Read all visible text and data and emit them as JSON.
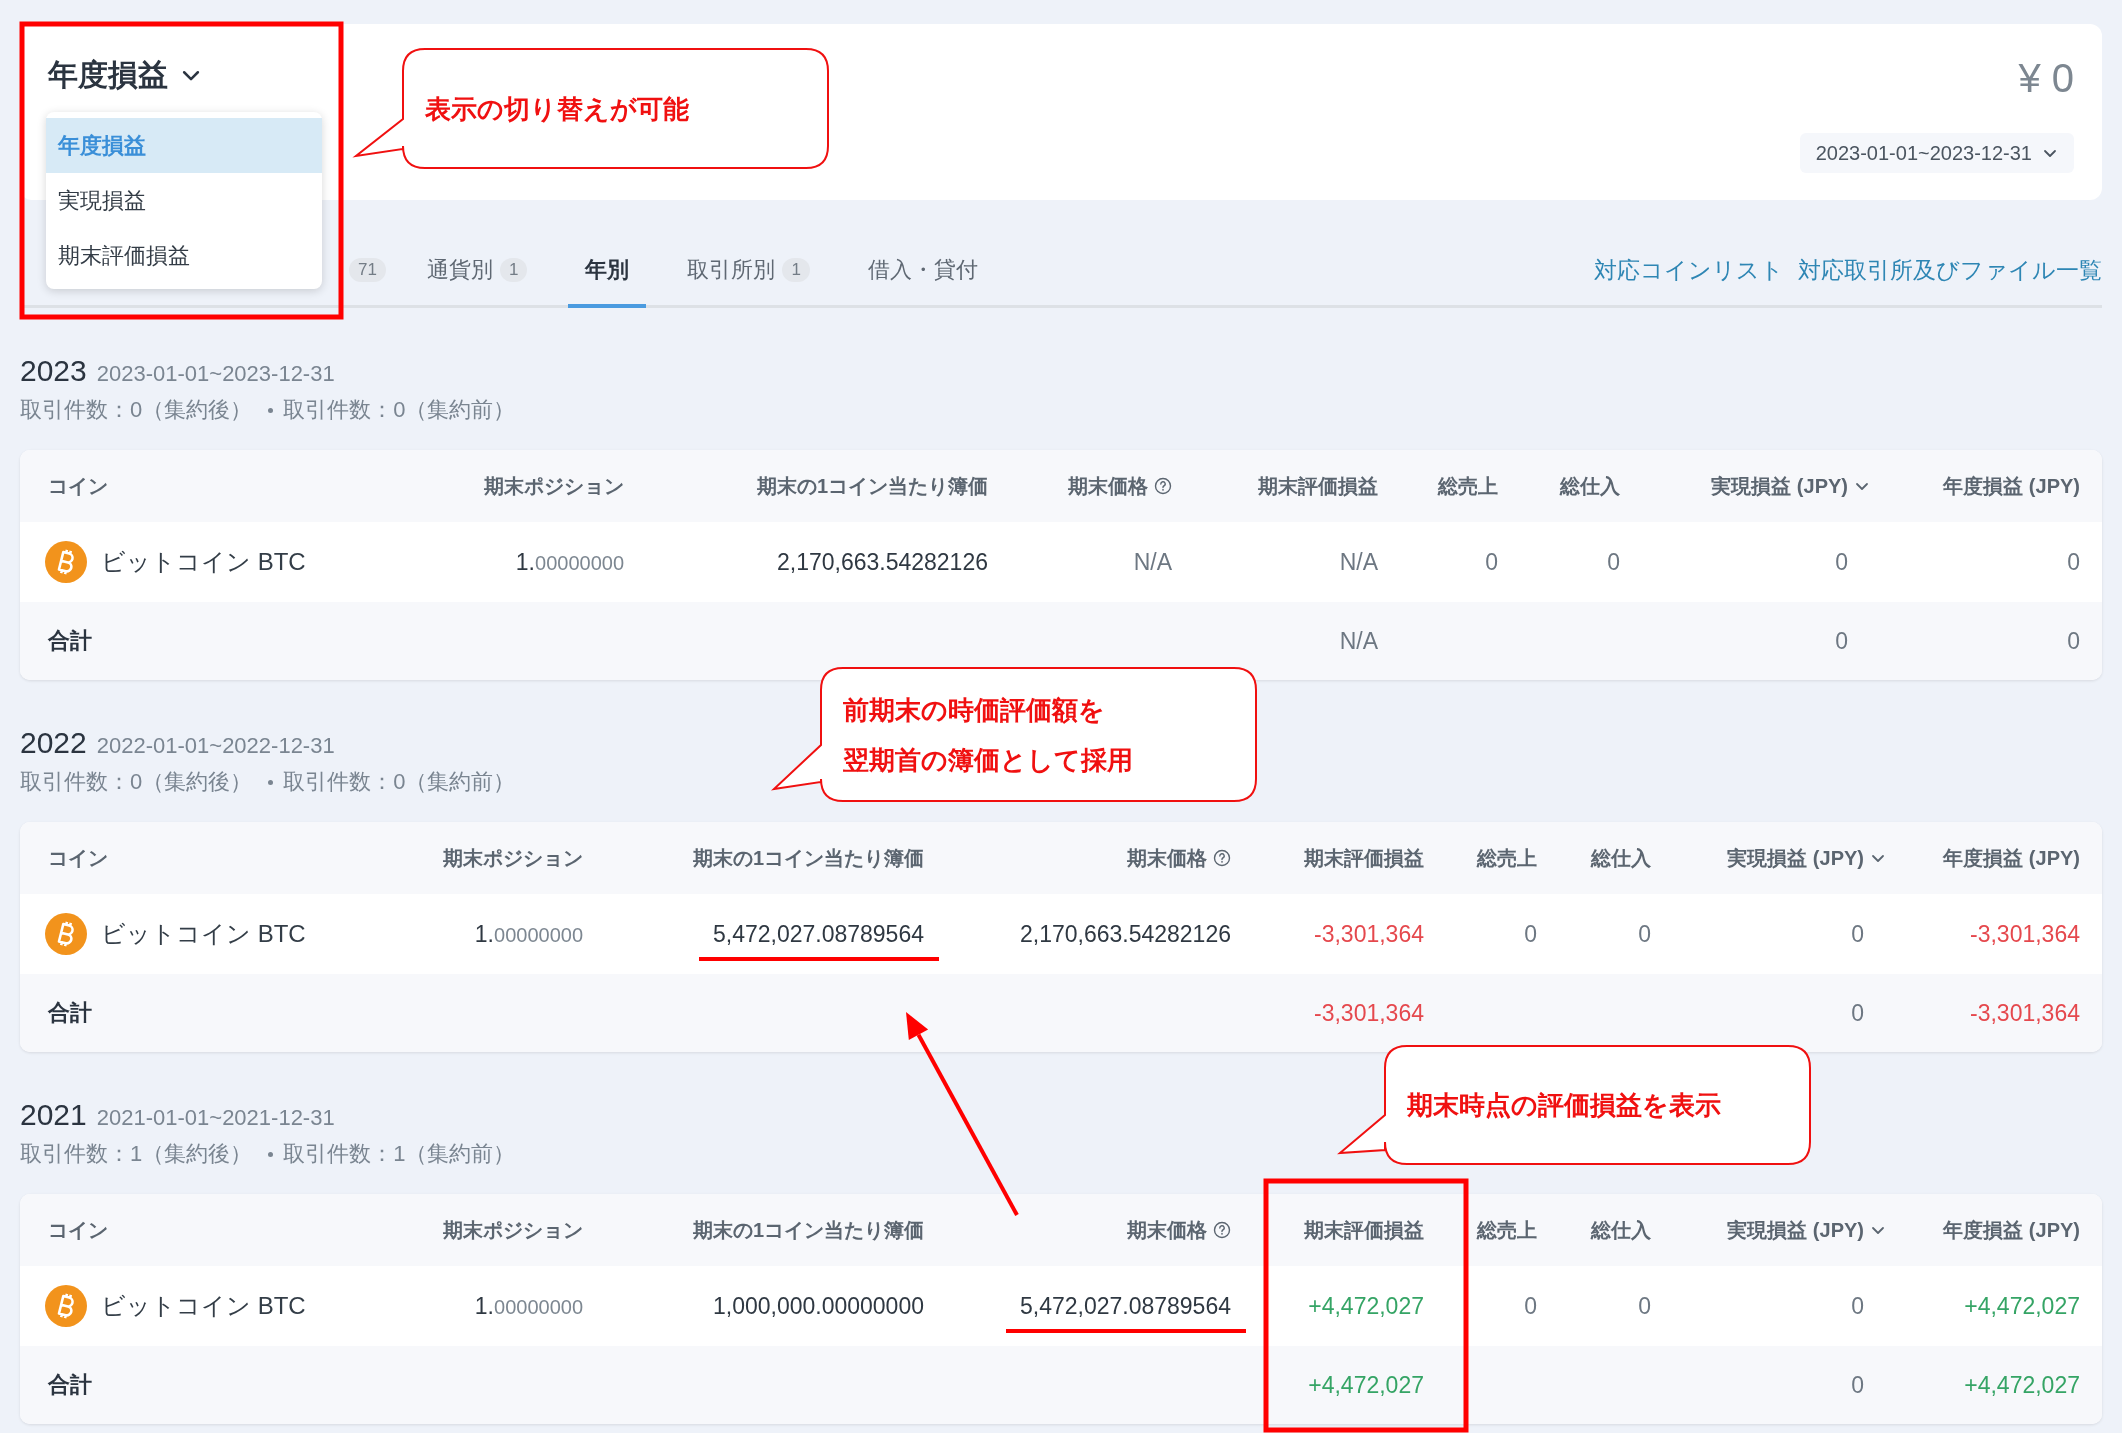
{
  "summary_card": {
    "view_menu": {
      "label": "年度損益",
      "options": [
        {
          "label": "年度損益",
          "selected": true
        },
        {
          "label": "実現損益",
          "selected": false
        },
        {
          "label": "期末評価損益",
          "selected": false
        }
      ]
    },
    "total": "¥ 0",
    "period": "2023-01-01~2023-12-31"
  },
  "tabs": [
    {
      "count": "71",
      "selected": false
    },
    {
      "label": "通貨別",
      "count": "1",
      "selected": false
    },
    {
      "label": "年別",
      "selected": true
    },
    {
      "label": "取引所別",
      "count": "1",
      "selected": false
    },
    {
      "label": "借入・貸付",
      "selected": false
    }
  ],
  "links": [
    "対応コインリスト",
    "対応取引所及びファイル一覧"
  ],
  "sections": [
    {
      "year": "2023",
      "period": "2023-01-01~2023-12-31",
      "counts": [
        "取引件数：0（集約後）",
        "取引件数：0（集約前）"
      ],
      "table": {
        "columns": [
          {
            "label": "コイン",
            "kind": "plain"
          },
          {
            "label": "期末ポジション",
            "kind": "plain"
          },
          {
            "label": "期末の1コイン当たり簿価",
            "kind": "plain"
          },
          {
            "label": "期末価格",
            "kind": "help"
          },
          {
            "label": "期末評価損益",
            "kind": "plain"
          },
          {
            "label": "総売上",
            "kind": "plain"
          },
          {
            "label": "総仕入",
            "kind": "plain"
          },
          {
            "label": "実現損益 (JPY)",
            "kind": "dropdown"
          },
          {
            "label": "年度損益 (JPY)",
            "kind": "plain"
          }
        ],
        "rows": [
          {
            "kind": "item",
            "cells": [
              {
                "kind": "coin",
                "text": "ビットコイン BTC"
              },
              {
                "kind": "normal",
                "text": "1.",
                "decimals": "00000000"
              },
              {
                "kind": "normal",
                "text": "2,170,663.54282126"
              },
              {
                "kind": "muted",
                "text": "N/A"
              },
              {
                "kind": "muted",
                "text": "N/A"
              },
              {
                "kind": "muted",
                "text": "0"
              },
              {
                "kind": "muted",
                "text": "0"
              },
              {
                "kind": "muted",
                "text": "0"
              },
              {
                "kind": "muted",
                "text": "0"
              }
            ]
          },
          {
            "kind": "total",
            "cells": [
              {
                "kind": "label",
                "text": "合計"
              },
              "",
              "",
              "",
              {
                "kind": "muted",
                "text": "N/A"
              },
              "",
              "",
              {
                "kind": "muted",
                "text": "0"
              },
              {
                "kind": "muted",
                "text": "0"
              }
            ]
          }
        ]
      }
    },
    {
      "year": "2022",
      "period": "2022-01-01~2022-12-31",
      "counts": [
        "取引件数：0（集約後）",
        "取引件数：0（集約前）"
      ],
      "table": {
        "columns": [
          {
            "label": "コイン",
            "kind": "plain"
          },
          {
            "label": "期末ポジション",
            "kind": "plain"
          },
          {
            "label": "期末の1コイン当たり簿価",
            "kind": "plain"
          },
          {
            "label": "期末価格",
            "kind": "help"
          },
          {
            "label": "期末評価損益",
            "kind": "plain"
          },
          {
            "label": "総売上",
            "kind": "plain"
          },
          {
            "label": "総仕入",
            "kind": "plain"
          },
          {
            "label": "実現損益 (JPY)",
            "kind": "dropdown"
          },
          {
            "label": "年度損益 (JPY)",
            "kind": "plain"
          }
        ],
        "rows": [
          {
            "kind": "item",
            "cells": [
              {
                "kind": "coin",
                "text": "ビットコイン BTC"
              },
              {
                "kind": "normal",
                "text": "1.",
                "decimals": "00000000"
              },
              {
                "kind": "normal",
                "text": "5,472,027.08789564",
                "underlined": true
              },
              {
                "kind": "normal",
                "text": "2,170,663.54282126"
              },
              {
                "kind": "negative",
                "text": "-3,301,364"
              },
              {
                "kind": "muted",
                "text": "0"
              },
              {
                "kind": "muted",
                "text": "0"
              },
              {
                "kind": "muted",
                "text": "0"
              },
              {
                "kind": "negative",
                "text": "-3,301,364"
              }
            ]
          },
          {
            "kind": "total",
            "cells": [
              {
                "kind": "label",
                "text": "合計"
              },
              "",
              "",
              "",
              {
                "kind": "negative",
                "text": "-3,301,364"
              },
              "",
              "",
              {
                "kind": "muted",
                "text": "0"
              },
              {
                "kind": "negative",
                "text": "-3,301,364"
              }
            ]
          }
        ]
      }
    },
    {
      "year": "2021",
      "period": "2021-01-01~2021-12-31",
      "counts": [
        "取引件数：1（集約後）",
        "取引件数：1（集約前）"
      ],
      "table": {
        "columns": [
          {
            "label": "コイン",
            "kind": "plain"
          },
          {
            "label": "期末ポジション",
            "kind": "plain"
          },
          {
            "label": "期末の1コイン当たり簿価",
            "kind": "plain"
          },
          {
            "label": "期末価格",
            "kind": "help"
          },
          {
            "label": "期末評価損益",
            "kind": "plain"
          },
          {
            "label": "総売上",
            "kind": "plain"
          },
          {
            "label": "総仕入",
            "kind": "plain"
          },
          {
            "label": "実現損益 (JPY)",
            "kind": "dropdown"
          },
          {
            "label": "年度損益 (JPY)",
            "kind": "plain"
          }
        ],
        "rows": [
          {
            "kind": "item",
            "cells": [
              {
                "kind": "coin",
                "text": "ビットコイン BTC"
              },
              {
                "kind": "normal",
                "text": "1.",
                "decimals": "00000000"
              },
              {
                "kind": "normal",
                "text": "1,000,000.00000000"
              },
              {
                "kind": "normal",
                "text": "5,472,027.08789564",
                "underlined": true
              },
              {
                "kind": "positive",
                "text": "+4,472,027"
              },
              {
                "kind": "muted",
                "text": "0"
              },
              {
                "kind": "muted",
                "text": "0"
              },
              {
                "kind": "muted",
                "text": "0"
              },
              {
                "kind": "positive",
                "text": "+4,472,027"
              }
            ]
          },
          {
            "kind": "total",
            "cells": [
              {
                "kind": "label",
                "text": "合計"
              },
              "",
              "",
              "",
              {
                "kind": "positive",
                "text": "+4,472,027"
              },
              "",
              "",
              {
                "kind": "muted",
                "text": "0"
              },
              {
                "kind": "positive",
                "text": "+4,472,027"
              }
            ]
          }
        ]
      }
    }
  ],
  "annotations": [
    {
      "kind": "callout",
      "lines": [
        "表示の切り替えが可能"
      ]
    },
    {
      "kind": "frame"
    },
    {
      "kind": "callout",
      "lines": [
        "前期末の時価評価額を",
        "翌期首の簿価として採用"
      ]
    },
    {
      "kind": "arrow"
    },
    {
      "kind": "callout",
      "lines": [
        "期末時点の評価損益を表示"
      ]
    },
    {
      "kind": "frame"
    }
  ]
}
